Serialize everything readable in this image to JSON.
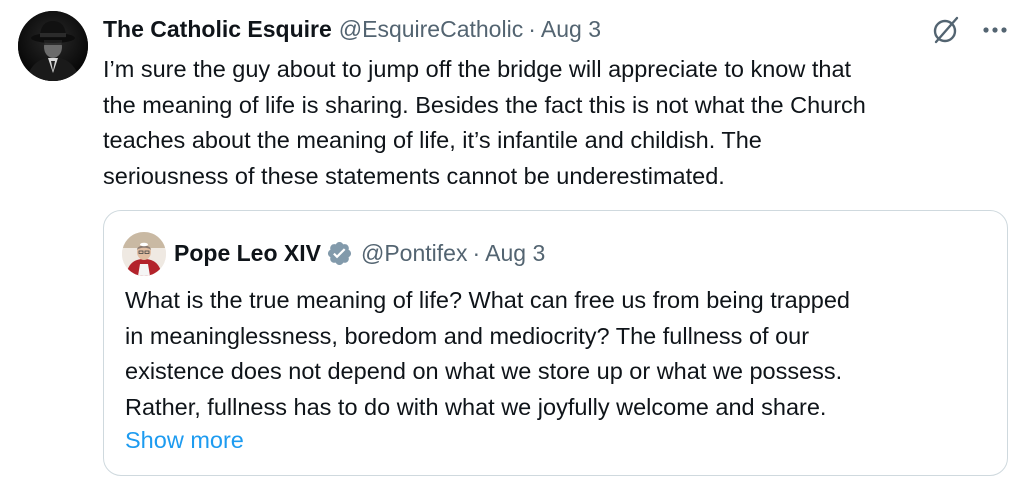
{
  "tweet": {
    "author_name": "The Catholic Esquire",
    "author_handle": "@EsquireCatholic",
    "separator": "·",
    "date": "Aug 3",
    "text_lines": [
      "I’m sure the guy about to jump off the bridge will appreciate to know that",
      "the meaning of life is sharing. Besides the fact this is not what the Church",
      "teaches about the meaning of life, it’s infantile and childish. The",
      "seriousness of these statements cannot be underestimated."
    ],
    "icons": {
      "avatar": "man-in-fedora-avatar",
      "grok": "grok-icon",
      "more": "more-options-icon"
    }
  },
  "quoted_tweet": {
    "author_name": "Pope Leo XIV",
    "author_handle": "@Pontifex",
    "separator": "·",
    "date": "Aug 3",
    "verified_icon": "gray-verified-badge-icon",
    "verified_color": "#829aab",
    "text_lines": [
      "What is the true meaning of life?  What can free us from being trapped",
      "in meaninglessness, boredom and mediocrity? The fullness of our",
      "existence does not depend on what we store up or what we possess.",
      "Rather, fullness has to do with what we joyfully welcome and share."
    ],
    "show_more": "Show more"
  },
  "colors": {
    "text_primary": "#0f1419",
    "text_secondary": "#536471",
    "link": "#1d9bf0",
    "border": "#cfd9de"
  }
}
